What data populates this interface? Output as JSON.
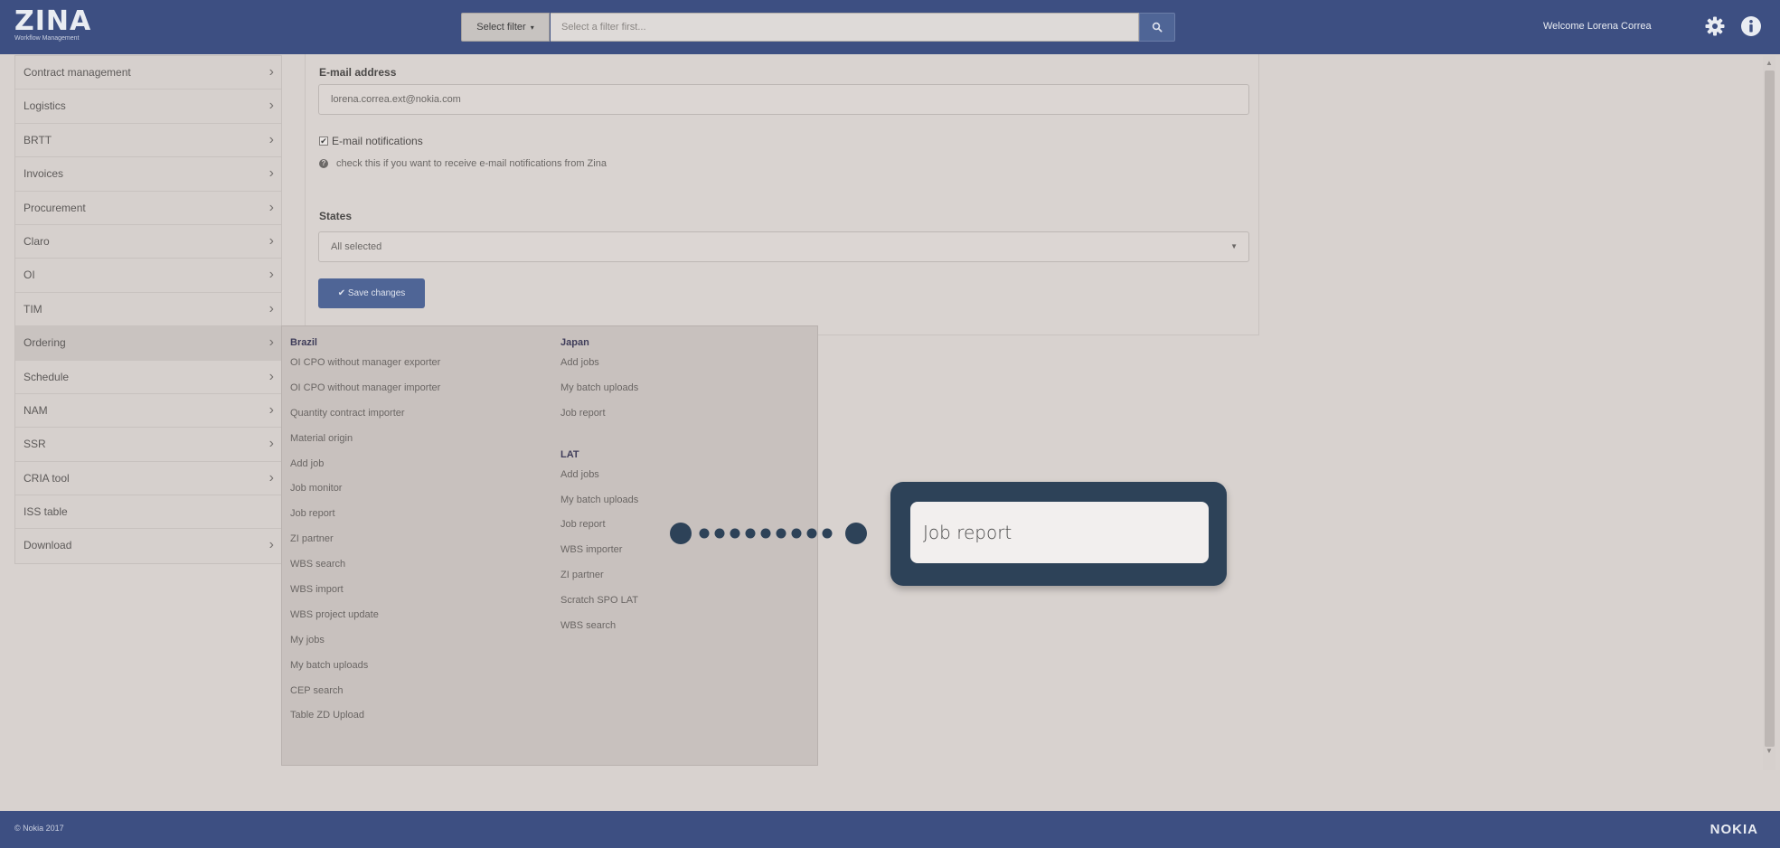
{
  "header": {
    "logo_title": "ZINA",
    "logo_subtitle": "Workflow Management",
    "filter_button_label": "Select filter",
    "filter_placeholder": "Select a filter first...",
    "welcome_text": "Welcome Lorena Correa",
    "colors": {
      "bar": "#3d4f82",
      "accent": "#4f6596"
    }
  },
  "sidebar": {
    "items": [
      {
        "label": "Contract management",
        "has_submenu": true
      },
      {
        "label": "Logistics",
        "has_submenu": true
      },
      {
        "label": "BRTT",
        "has_submenu": true
      },
      {
        "label": "Invoices",
        "has_submenu": true
      },
      {
        "label": "Procurement",
        "has_submenu": true
      },
      {
        "label": "Claro",
        "has_submenu": true
      },
      {
        "label": "OI",
        "has_submenu": true
      },
      {
        "label": "TIM",
        "has_submenu": true
      },
      {
        "label": "Ordering",
        "has_submenu": true,
        "active": true
      },
      {
        "label": "Schedule",
        "has_submenu": true
      },
      {
        "label": "NAM",
        "has_submenu": true
      },
      {
        "label": "SSR",
        "has_submenu": true
      },
      {
        "label": "CRIA tool",
        "has_submenu": true
      },
      {
        "label": "ISS table",
        "has_submenu": false
      },
      {
        "label": "Download",
        "has_submenu": true
      }
    ]
  },
  "form": {
    "email_label": "E-mail address",
    "email_value": "lorena.correa.ext@nokia.com",
    "notifications_label": "E-mail notifications",
    "notifications_checked": true,
    "notifications_help": "check this if you want to receive e-mail notifications from Zina",
    "states_label": "States",
    "states_value": "All selected",
    "save_label": "Save changes"
  },
  "menu": {
    "brazil": {
      "heading": "Brazil",
      "items": [
        "OI CPO without manager exporter",
        "OI CPO without manager importer",
        "Quantity contract importer",
        "Material origin",
        "Add job",
        "Job monitor",
        "Job report",
        "ZI partner",
        "WBS search",
        "WBS import",
        "WBS project update",
        "My jobs",
        "My batch uploads",
        "CEP search",
        "Table ZD Upload"
      ]
    },
    "japan": {
      "heading": "Japan",
      "items": [
        "Add jobs",
        "My batch uploads",
        "Job report"
      ]
    },
    "lat": {
      "heading": "LAT",
      "items": [
        "Add jobs",
        "My batch uploads",
        "Job report",
        "WBS importer",
        "ZI partner",
        "Scratch SPO LAT",
        "WBS search"
      ]
    }
  },
  "callout": {
    "text": "Job report"
  },
  "footer": {
    "copyright": "© Nokia 2017",
    "brand": "NOKIA"
  }
}
